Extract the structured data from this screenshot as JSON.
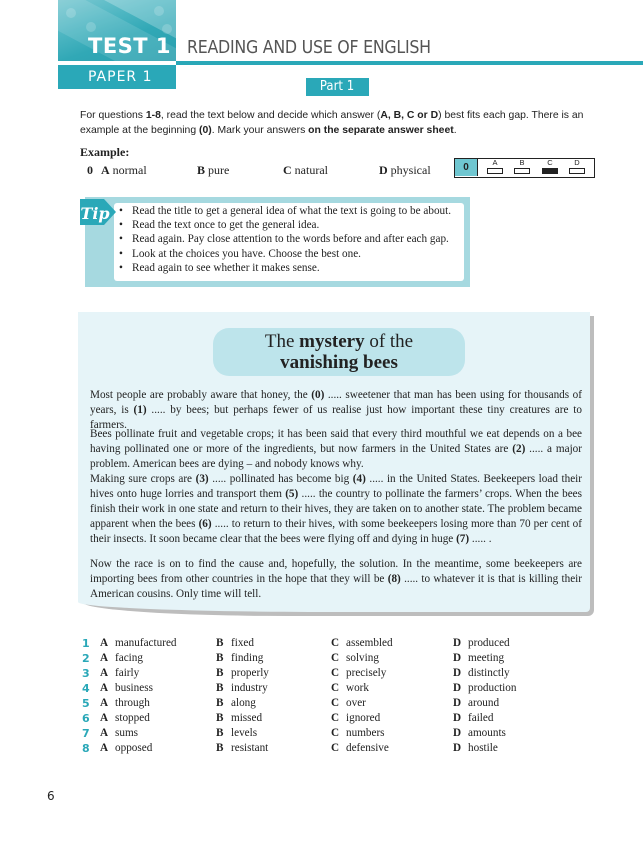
{
  "header": {
    "test_label": "TEST 1",
    "section_title": "READING AND USE OF ENGLISH",
    "paper_label": "PAPER 1",
    "part_label": "Part 1"
  },
  "instructions": {
    "t1": "For questions ",
    "b1": "1-8",
    "t2": ", read the text below and decide which answer (",
    "b2": "A, B, C or D",
    "t3": ") best fits each gap. There is an example at the beginning ",
    "b3": "(0)",
    "t4": ". Mark your answers ",
    "b4": "on the separate answer sheet",
    "t5": "."
  },
  "example": {
    "label": "Example:",
    "number": "0",
    "options": [
      {
        "letter": "A",
        "text": "normal"
      },
      {
        "letter": "B",
        "text": "pure"
      },
      {
        "letter": "C",
        "text": "natural"
      },
      {
        "letter": "D",
        "text": "physical"
      }
    ],
    "answer_box": {
      "number": "0",
      "letters": [
        "A",
        "B",
        "C",
        "D"
      ],
      "selected": "C"
    }
  },
  "tip": {
    "badge": "Tip",
    "items": [
      "Read the title to get a general idea of what the text is going to be about.",
      "Read the text once to get the general idea.",
      "Read again. Pay close attention to the words before and after each gap.",
      "Look at the choices you have. Choose the best one.",
      "Read again to see whether it makes sense."
    ]
  },
  "article": {
    "title_part1": "The ",
    "title_bold": "mystery",
    "title_part2": " of the",
    "title_line2": "vanishing bees",
    "p1": {
      "a": "Most people are probably aware that honey, the ",
      "g0": "(0)",
      "b": " ..... sweetener that man has been using for thousands of years, is ",
      "g1": "(1)",
      "c": " ..... by bees; but perhaps fewer of us realise just how important these tiny creatures are to farmers."
    },
    "p2": {
      "a": "Bees pollinate fruit and vegetable crops; it has been said that every third mouthful we eat depends on a bee having pollinated one or more of the ingredients, but now farmers in the United States are ",
      "g2": "(2)",
      "b": " ..... a major problem. American bees are dying – and nobody knows why."
    },
    "p3": {
      "a": "Making sure crops are ",
      "g3": "(3)",
      "b": " ..... pollinated has become big ",
      "g4": "(4)",
      "c": " ..... in the United States. Beekeepers load their hives onto huge lorries and transport them ",
      "g5": "(5)",
      "d": " ..... the country to pollinate the farmers’ crops. When the bees finish their work in one state and return to their hives, they are taken on to another state. The problem became apparent when the bees ",
      "g6": "(6)",
      "e": " ..... to return to their hives, with some beekeepers losing more than 70 per cent of their insects. It soon became clear that the bees were flying off and dying in huge ",
      "g7": "(7)",
      "f": " ..... ."
    },
    "p4": {
      "a": "Now the race is on to find the cause and, hopefully, the solution. In the meantime, some beekeepers are importing bees from other countries in the hope that they will be ",
      "g8": "(8)",
      "b": " ..... to whatever it is that is killing their American cousins. Only time will tell."
    }
  },
  "questions": [
    {
      "num": "1",
      "A": "manufactured",
      "B": "fixed",
      "C": "assembled",
      "D": "produced"
    },
    {
      "num": "2",
      "A": "facing",
      "B": "finding",
      "C": "solving",
      "D": "meeting"
    },
    {
      "num": "3",
      "A": "fairly",
      "B": "properly",
      "C": "precisely",
      "D": "distinctly"
    },
    {
      "num": "4",
      "A": "business",
      "B": "industry",
      "C": "work",
      "D": "production"
    },
    {
      "num": "5",
      "A": "through",
      "B": "along",
      "C": "over",
      "D": "around"
    },
    {
      "num": "6",
      "A": "stopped",
      "B": "missed",
      "C": "ignored",
      "D": "failed"
    },
    {
      "num": "7",
      "A": "sums",
      "B": "levels",
      "C": "numbers",
      "D": "amounts"
    },
    {
      "num": "8",
      "A": "opposed",
      "B": "resistant",
      "C": "defensive",
      "D": "hostile"
    }
  ],
  "letters": {
    "A": "A",
    "B": "B",
    "C": "C",
    "D": "D"
  },
  "page_number": "6",
  "colors": {
    "accent": "#2aa8b8",
    "tip_bg": "#a6d9e0",
    "panel_bg": "#e6f4f8",
    "title_pill": "#bde4eb"
  }
}
